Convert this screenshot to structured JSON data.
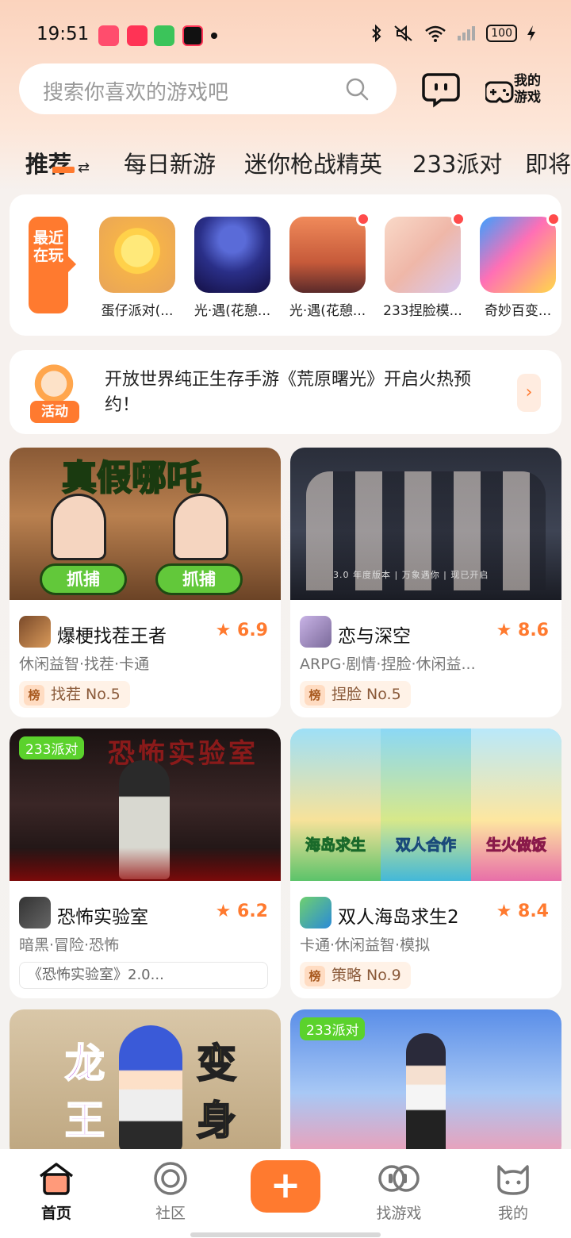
{
  "status": {
    "time": "19:51",
    "battery": "100"
  },
  "search": {
    "placeholder": "搜索你喜欢的游戏吧"
  },
  "header": {
    "my_games_line1": "我的",
    "my_games_line2": "游戏"
  },
  "tabs": [
    "推荐",
    "每日新游",
    "迷你枪战精英",
    "233派对",
    "即将"
  ],
  "recent": {
    "label": "最近在玩",
    "items": [
      {
        "name": "蛋仔派对(...",
        "badge": false
      },
      {
        "name": "光·遇(花憩...",
        "badge": false
      },
      {
        "name": "光·遇(花憩...",
        "badge": true
      },
      {
        "name": "233捏脸模...",
        "badge": true
      },
      {
        "name": "奇妙百变...",
        "badge": true
      }
    ]
  },
  "activity": {
    "badge": "活动",
    "text": "开放世界纯正生存手游《荒原曙光》开启火热预约！"
  },
  "games": [
    {
      "banner_title": "真假哪吒",
      "banner_btn1": "抓捕",
      "banner_btn2": "抓捕",
      "name": "爆梗找茬王者",
      "rating": "6.9",
      "tags": "休闲益智·找茬·卡通",
      "rank_badge": "榜",
      "rank": "找茬 No.5"
    },
    {
      "banner_caption": "3.0 年度版本 | 万象遇你 | 现已开启",
      "name": "恋与深空",
      "rating": "8.6",
      "tags": "ARPG·剧情·捏脸·休闲益...",
      "rank_badge": "榜",
      "rank": "捏脸 No.5"
    },
    {
      "banner_tag": "233派对",
      "banner_title": "恐怖实验室",
      "name": "恐怖实验室",
      "rating": "6.2",
      "tags": "暗黑·冒险·恐怖",
      "news": "《恐怖实验室》2.0..."
    },
    {
      "panel1": "海岛求生",
      "panel2": "双人合作",
      "panel3": "生火做饭",
      "name": "双人海岛求生2",
      "rating": "8.4",
      "tags": "卡通·休闲益智·模拟",
      "rank_badge": "榜",
      "rank": "策略 No.9"
    },
    {
      "banner_chars": [
        "龙",
        "王",
        "变",
        "身"
      ]
    },
    {
      "banner_tag": "233派对"
    }
  ],
  "nav": [
    "首页",
    "社区",
    "找游戏",
    "我的"
  ],
  "colors": {
    "accent": "#ff7a2f",
    "tag_green": "#5bd22c"
  }
}
